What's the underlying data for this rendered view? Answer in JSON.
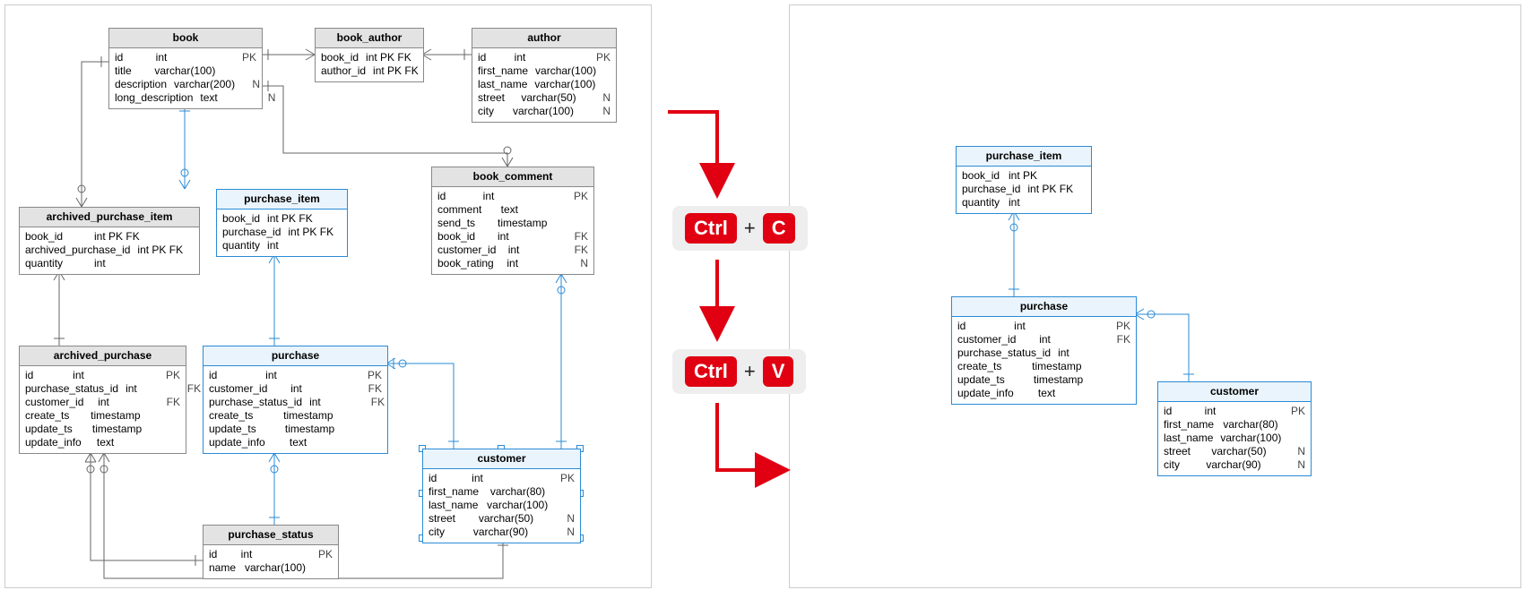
{
  "keys": {
    "ctrl": "Ctrl",
    "c": "C",
    "v": "V",
    "plus": "+"
  },
  "left": {
    "book": {
      "title": "book",
      "rows": [
        {
          "n": "id",
          "t": "int",
          "k": "PK"
        },
        {
          "n": "title",
          "t": "varchar(100)",
          "k": ""
        },
        {
          "n": "description",
          "t": "varchar(200)",
          "k": "N"
        },
        {
          "n": "long_description",
          "t": "text",
          "k": "N"
        }
      ]
    },
    "book_author": {
      "title": "book_author",
      "rows": [
        {
          "n": "book_id",
          "t": "int PK FK",
          "k": ""
        },
        {
          "n": "author_id",
          "t": "int PK FK",
          "k": ""
        }
      ]
    },
    "author": {
      "title": "author",
      "rows": [
        {
          "n": "id",
          "t": "int",
          "k": "PK"
        },
        {
          "n": "first_name",
          "t": "varchar(100)",
          "k": ""
        },
        {
          "n": "last_name",
          "t": "varchar(100)",
          "k": ""
        },
        {
          "n": "street",
          "t": "varchar(50)",
          "k": "N"
        },
        {
          "n": "city",
          "t": "varchar(100)",
          "k": "N"
        }
      ]
    },
    "book_comment": {
      "title": "book_comment",
      "rows": [
        {
          "n": "id",
          "t": "int",
          "k": "PK"
        },
        {
          "n": "comment",
          "t": "text",
          "k": ""
        },
        {
          "n": "send_ts",
          "t": "timestamp",
          "k": ""
        },
        {
          "n": "book_id",
          "t": "int",
          "k": "FK"
        },
        {
          "n": "customer_id",
          "t": "int",
          "k": "FK"
        },
        {
          "n": "book_rating",
          "t": "int",
          "k": "N"
        }
      ]
    },
    "archived_purchase_item": {
      "title": "archived_purchase_item",
      "rows": [
        {
          "n": "book_id",
          "t": "int PK FK",
          "k": ""
        },
        {
          "n": "archived_purchase_id",
          "t": "int PK FK",
          "k": ""
        },
        {
          "n": "quantity",
          "t": "int",
          "k": ""
        }
      ]
    },
    "purchase_item": {
      "title": "purchase_item",
      "rows": [
        {
          "n": "book_id",
          "t": "int PK FK",
          "k": ""
        },
        {
          "n": "purchase_id",
          "t": "int PK FK",
          "k": ""
        },
        {
          "n": "quantity",
          "t": "int",
          "k": ""
        }
      ]
    },
    "archived_purchase": {
      "title": "archived_purchase",
      "rows": [
        {
          "n": "id",
          "t": "int",
          "k": "PK"
        },
        {
          "n": "purchase_status_id",
          "t": "int",
          "k": "FK"
        },
        {
          "n": "customer_id",
          "t": "int",
          "k": "FK"
        },
        {
          "n": "create_ts",
          "t": "timestamp",
          "k": ""
        },
        {
          "n": "update_ts",
          "t": "timestamp",
          "k": ""
        },
        {
          "n": "update_info",
          "t": "text",
          "k": ""
        }
      ]
    },
    "purchase": {
      "title": "purchase",
      "rows": [
        {
          "n": "id",
          "t": "int",
          "k": "PK"
        },
        {
          "n": "customer_id",
          "t": "int",
          "k": "FK"
        },
        {
          "n": "purchase_status_id",
          "t": "int",
          "k": "FK"
        },
        {
          "n": "create_ts",
          "t": "timestamp",
          "k": ""
        },
        {
          "n": "update_ts",
          "t": "timestamp",
          "k": ""
        },
        {
          "n": "update_info",
          "t": "text",
          "k": ""
        }
      ]
    },
    "purchase_status": {
      "title": "purchase_status",
      "rows": [
        {
          "n": "id",
          "t": "int",
          "k": "PK"
        },
        {
          "n": "name",
          "t": "varchar(100)",
          "k": ""
        }
      ]
    },
    "customer": {
      "title": "customer",
      "rows": [
        {
          "n": "id",
          "t": "int",
          "k": "PK"
        },
        {
          "n": "first_name",
          "t": "varchar(80)",
          "k": ""
        },
        {
          "n": "last_name",
          "t": "varchar(100)",
          "k": ""
        },
        {
          "n": "street",
          "t": "varchar(50)",
          "k": "N"
        },
        {
          "n": "city",
          "t": "varchar(90)",
          "k": "N"
        }
      ]
    }
  },
  "right": {
    "purchase_item": {
      "title": "purchase_item",
      "rows": [
        {
          "n": "book_id",
          "t": "int PK",
          "k": ""
        },
        {
          "n": "purchase_id",
          "t": "int PK FK",
          "k": ""
        },
        {
          "n": "quantity",
          "t": "int",
          "k": ""
        }
      ]
    },
    "purchase": {
      "title": "purchase",
      "rows": [
        {
          "n": "id",
          "t": "int",
          "k": "PK"
        },
        {
          "n": "customer_id",
          "t": "int",
          "k": "FK"
        },
        {
          "n": "purchase_status_id",
          "t": "int",
          "k": ""
        },
        {
          "n": "create_ts",
          "t": "timestamp",
          "k": ""
        },
        {
          "n": "update_ts",
          "t": "timestamp",
          "k": ""
        },
        {
          "n": "update_info",
          "t": "text",
          "k": ""
        }
      ]
    },
    "customer": {
      "title": "customer",
      "rows": [
        {
          "n": "id",
          "t": "int",
          "k": "PK"
        },
        {
          "n": "first_name",
          "t": "varchar(80)",
          "k": ""
        },
        {
          "n": "last_name",
          "t": "varchar(100)",
          "k": ""
        },
        {
          "n": "street",
          "t": "varchar(50)",
          "k": "N"
        },
        {
          "n": "city",
          "t": "varchar(90)",
          "k": "N"
        }
      ]
    }
  }
}
